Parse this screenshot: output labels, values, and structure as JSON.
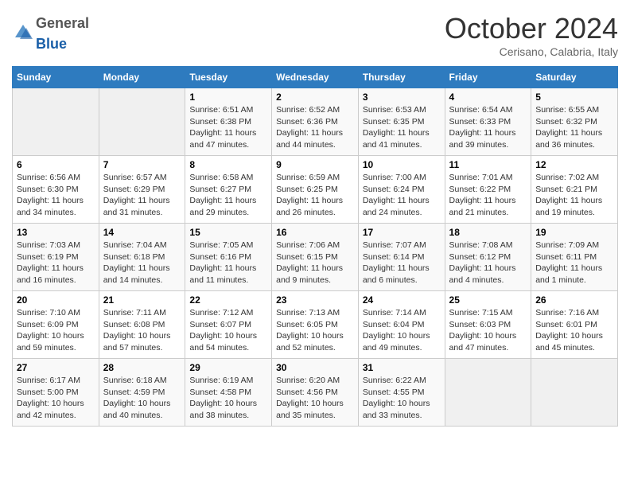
{
  "header": {
    "logo_general": "General",
    "logo_blue": "Blue",
    "month_title": "October 2024",
    "subtitle": "Cerisano, Calabria, Italy"
  },
  "days_of_week": [
    "Sunday",
    "Monday",
    "Tuesday",
    "Wednesday",
    "Thursday",
    "Friday",
    "Saturday"
  ],
  "weeks": [
    [
      {
        "day": "",
        "content": ""
      },
      {
        "day": "",
        "content": ""
      },
      {
        "day": "1",
        "content": "Sunrise: 6:51 AM\nSunset: 6:38 PM\nDaylight: 11 hours and 47 minutes."
      },
      {
        "day": "2",
        "content": "Sunrise: 6:52 AM\nSunset: 6:36 PM\nDaylight: 11 hours and 44 minutes."
      },
      {
        "day": "3",
        "content": "Sunrise: 6:53 AM\nSunset: 6:35 PM\nDaylight: 11 hours and 41 minutes."
      },
      {
        "day": "4",
        "content": "Sunrise: 6:54 AM\nSunset: 6:33 PM\nDaylight: 11 hours and 39 minutes."
      },
      {
        "day": "5",
        "content": "Sunrise: 6:55 AM\nSunset: 6:32 PM\nDaylight: 11 hours and 36 minutes."
      }
    ],
    [
      {
        "day": "6",
        "content": "Sunrise: 6:56 AM\nSunset: 6:30 PM\nDaylight: 11 hours and 34 minutes."
      },
      {
        "day": "7",
        "content": "Sunrise: 6:57 AM\nSunset: 6:29 PM\nDaylight: 11 hours and 31 minutes."
      },
      {
        "day": "8",
        "content": "Sunrise: 6:58 AM\nSunset: 6:27 PM\nDaylight: 11 hours and 29 minutes."
      },
      {
        "day": "9",
        "content": "Sunrise: 6:59 AM\nSunset: 6:25 PM\nDaylight: 11 hours and 26 minutes."
      },
      {
        "day": "10",
        "content": "Sunrise: 7:00 AM\nSunset: 6:24 PM\nDaylight: 11 hours and 24 minutes."
      },
      {
        "day": "11",
        "content": "Sunrise: 7:01 AM\nSunset: 6:22 PM\nDaylight: 11 hours and 21 minutes."
      },
      {
        "day": "12",
        "content": "Sunrise: 7:02 AM\nSunset: 6:21 PM\nDaylight: 11 hours and 19 minutes."
      }
    ],
    [
      {
        "day": "13",
        "content": "Sunrise: 7:03 AM\nSunset: 6:19 PM\nDaylight: 11 hours and 16 minutes."
      },
      {
        "day": "14",
        "content": "Sunrise: 7:04 AM\nSunset: 6:18 PM\nDaylight: 11 hours and 14 minutes."
      },
      {
        "day": "15",
        "content": "Sunrise: 7:05 AM\nSunset: 6:16 PM\nDaylight: 11 hours and 11 minutes."
      },
      {
        "day": "16",
        "content": "Sunrise: 7:06 AM\nSunset: 6:15 PM\nDaylight: 11 hours and 9 minutes."
      },
      {
        "day": "17",
        "content": "Sunrise: 7:07 AM\nSunset: 6:14 PM\nDaylight: 11 hours and 6 minutes."
      },
      {
        "day": "18",
        "content": "Sunrise: 7:08 AM\nSunset: 6:12 PM\nDaylight: 11 hours and 4 minutes."
      },
      {
        "day": "19",
        "content": "Sunrise: 7:09 AM\nSunset: 6:11 PM\nDaylight: 11 hours and 1 minute."
      }
    ],
    [
      {
        "day": "20",
        "content": "Sunrise: 7:10 AM\nSunset: 6:09 PM\nDaylight: 10 hours and 59 minutes."
      },
      {
        "day": "21",
        "content": "Sunrise: 7:11 AM\nSunset: 6:08 PM\nDaylight: 10 hours and 57 minutes."
      },
      {
        "day": "22",
        "content": "Sunrise: 7:12 AM\nSunset: 6:07 PM\nDaylight: 10 hours and 54 minutes."
      },
      {
        "day": "23",
        "content": "Sunrise: 7:13 AM\nSunset: 6:05 PM\nDaylight: 10 hours and 52 minutes."
      },
      {
        "day": "24",
        "content": "Sunrise: 7:14 AM\nSunset: 6:04 PM\nDaylight: 10 hours and 49 minutes."
      },
      {
        "day": "25",
        "content": "Sunrise: 7:15 AM\nSunset: 6:03 PM\nDaylight: 10 hours and 47 minutes."
      },
      {
        "day": "26",
        "content": "Sunrise: 7:16 AM\nSunset: 6:01 PM\nDaylight: 10 hours and 45 minutes."
      }
    ],
    [
      {
        "day": "27",
        "content": "Sunrise: 6:17 AM\nSunset: 5:00 PM\nDaylight: 10 hours and 42 minutes."
      },
      {
        "day": "28",
        "content": "Sunrise: 6:18 AM\nSunset: 4:59 PM\nDaylight: 10 hours and 40 minutes."
      },
      {
        "day": "29",
        "content": "Sunrise: 6:19 AM\nSunset: 4:58 PM\nDaylight: 10 hours and 38 minutes."
      },
      {
        "day": "30",
        "content": "Sunrise: 6:20 AM\nSunset: 4:56 PM\nDaylight: 10 hours and 35 minutes."
      },
      {
        "day": "31",
        "content": "Sunrise: 6:22 AM\nSunset: 4:55 PM\nDaylight: 10 hours and 33 minutes."
      },
      {
        "day": "",
        "content": ""
      },
      {
        "day": "",
        "content": ""
      }
    ]
  ]
}
